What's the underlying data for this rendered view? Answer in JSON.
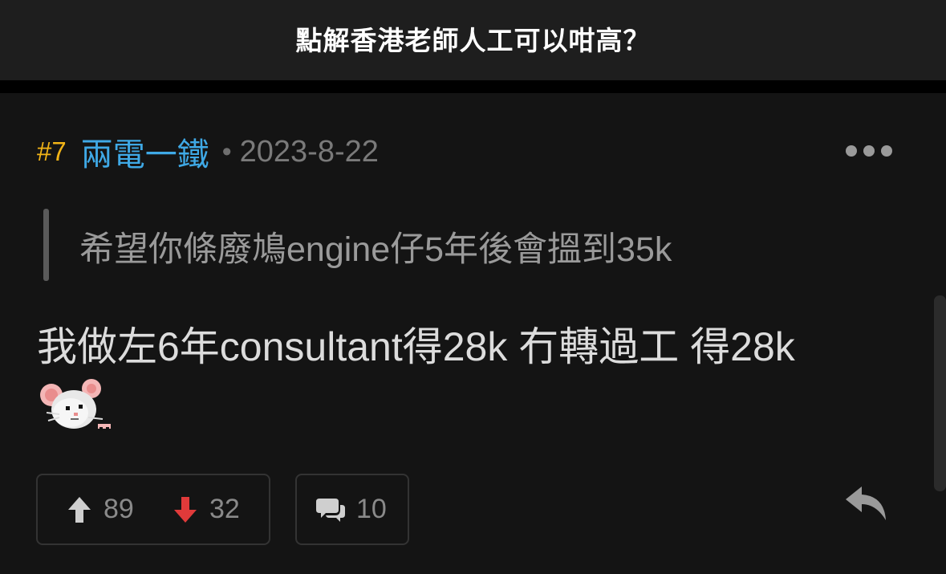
{
  "header": {
    "title": "點解香港老師人工可以咁高？"
  },
  "post": {
    "floor": "#7",
    "author": "兩電一鐵",
    "separator": "•",
    "date": "2023-8-22",
    "quote": "希望你條廢鳩engine仔5年後會搵到35k",
    "content": "我做左6年consultant得28k 冇轉過工 得28k",
    "sticker": "mouse-sticker"
  },
  "actions": {
    "upvotes": "89",
    "downvotes": "32",
    "comments": "10"
  },
  "colors": {
    "floor": "#f2b417",
    "author": "#3fa9e6",
    "downvote": "#e03a3a"
  }
}
